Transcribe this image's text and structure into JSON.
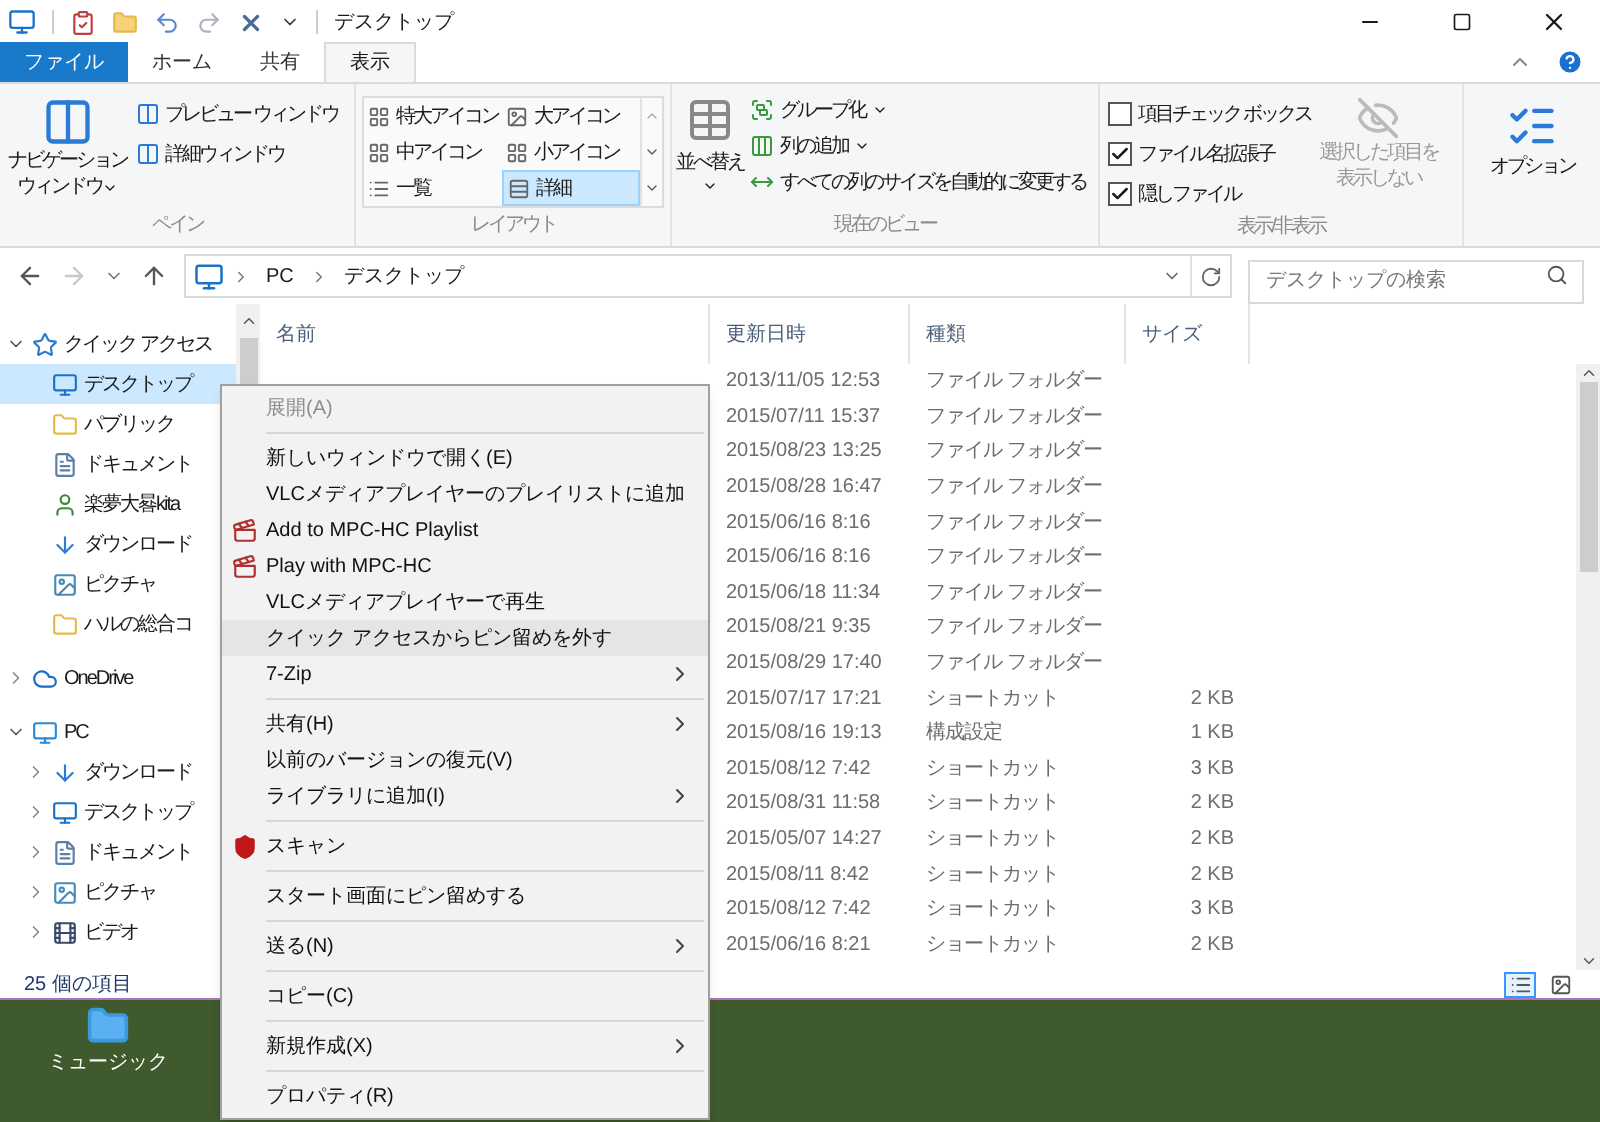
{
  "window": {
    "title": "デスクトップ"
  },
  "ribbon_tabs": [
    {
      "label": "ファイル",
      "kind": "file",
      "selected": false
    },
    {
      "label": "ホーム",
      "kind": "tab",
      "selected": false
    },
    {
      "label": "共有",
      "kind": "tab",
      "selected": false
    },
    {
      "label": "表示",
      "kind": "tab",
      "selected": true
    }
  ],
  "panes": {
    "title": "ペイン",
    "navigation_button": [
      "ナビゲーション",
      "ウィンドウ"
    ],
    "buttons": [
      "プレビュー ウィンドウ",
      "詳細ウィンドウ"
    ]
  },
  "layout": {
    "title": "レイアウト",
    "options": [
      {
        "label": "特大アイコン",
        "selected": false
      },
      {
        "label": "大アイコン",
        "selected": false
      },
      {
        "label": "中アイコン",
        "selected": false
      },
      {
        "label": "小アイコン",
        "selected": false
      },
      {
        "label": "一覧",
        "selected": false
      },
      {
        "label": "詳細",
        "selected": true
      }
    ]
  },
  "current_view": {
    "title": "現在のビュー",
    "sort_button": "並べ替え",
    "buttons": [
      {
        "label": "グループ化",
        "dropdown": true
      },
      {
        "label": "列の追加",
        "dropdown": true
      },
      {
        "label": "すべての列のサイズを自動的に変更する",
        "dropdown": false
      }
    ]
  },
  "show_hide": {
    "title": "表示/非表示",
    "checkboxes": [
      {
        "label": "項目チェック ボックス",
        "checked": false
      },
      {
        "label": "ファイル名拡張子",
        "checked": true
      },
      {
        "label": "隠しファイル",
        "checked": true
      }
    ],
    "hide_button": {
      "lines": [
        "選択した項目を",
        "表示しない"
      ],
      "disabled": true
    }
  },
  "options_button": "オプション",
  "address": {
    "forward_disabled": true,
    "path": [
      "PC",
      "デスクトップ"
    ],
    "search_placeholder": "デスクトップの検索"
  },
  "navigation": [
    {
      "label": "クイック アクセス",
      "kind": "star",
      "expanded": true,
      "selected": false,
      "children": [
        {
          "label": "デスクトップ",
          "kind": "desktop",
          "selected": true
        },
        {
          "label": "パブリック",
          "kind": "folder",
          "selected": false
        },
        {
          "label": "ドキュメント",
          "kind": "document",
          "selected": false
        },
        {
          "label": "楽夢大晷kita",
          "kind": "user",
          "selected": false
        },
        {
          "label": "ダウンロード",
          "kind": "download",
          "selected": false
        },
        {
          "label": "ピクチャ",
          "kind": "pictures",
          "selected": false
        },
        {
          "label": "ハルの総合コ",
          "kind": "folder",
          "selected": false
        }
      ]
    },
    {
      "label": "OneDrive",
      "kind": "cloud",
      "expanded": false,
      "selected": false
    },
    {
      "label": "PC",
      "kind": "pc",
      "expanded": true,
      "selected": false,
      "children": [
        {
          "label": "ダウンロード",
          "kind": "download",
          "expanded": false,
          "selected": false
        },
        {
          "label": "デスクトップ",
          "kind": "desktop",
          "expanded": false,
          "selected": false
        },
        {
          "label": "ドキュメント",
          "kind": "document",
          "expanded": false,
          "selected": false
        },
        {
          "label": "ピクチャ",
          "kind": "pictures",
          "expanded": false,
          "selected": false
        },
        {
          "label": "ビデオ",
          "kind": "video",
          "expanded": false,
          "selected": false
        }
      ]
    }
  ],
  "file_list": {
    "columns": [
      "名前",
      "更新日時",
      "種類",
      "サイズ"
    ],
    "rows": [
      {
        "modified": "2013/11/05 12:53",
        "type": "ファイル フォルダー"
      },
      {
        "modified": "2015/07/11 15:37",
        "type": "ファイル フォルダー"
      },
      {
        "modified": "2015/08/23 13:25",
        "type": "ファイル フォルダー"
      },
      {
        "modified": "2015/08/28 16:47",
        "type": "ファイル フォルダー"
      },
      {
        "modified": "2015/06/16 8:16",
        "type": "ファイル フォルダー"
      },
      {
        "modified": "2015/06/16 8:16",
        "type": "ファイル フォルダー"
      },
      {
        "modified": "2015/06/18 11:34",
        "type": "ファイル フォルダー"
      },
      {
        "modified": "2015/08/21 9:35",
        "type": "ファイル フォルダー"
      },
      {
        "modified": "2015/08/29 17:40",
        "type": "ファイル フォルダー"
      },
      {
        "modified": "2015/07/17 17:21",
        "type": "ショートカット",
        "size": "2 KB"
      },
      {
        "modified": "2015/08/16 19:13",
        "type": "構成設定",
        "size": "1 KB"
      },
      {
        "modified": "2015/08/12 7:42",
        "type": "ショートカット",
        "size": "3 KB"
      },
      {
        "modified": "2015/08/31 11:58",
        "type": "ショートカット",
        "size": "2 KB"
      },
      {
        "modified": "2015/05/07 14:27",
        "type": "ショートカット",
        "size": "2 KB"
      },
      {
        "modified": "2015/08/11 8:42",
        "type": "ショートカット",
        "size": "2 KB"
      },
      {
        "modified": "2015/08/12 7:42",
        "type": "ショートカット",
        "size": "3 KB"
      },
      {
        "modified": "2015/06/16 8:21",
        "type": "ショートカット",
        "size": "2 KB"
      }
    ]
  },
  "status_bar": {
    "item_count": "25 個の項目",
    "views": [
      {
        "kind": "details",
        "selected": true
      },
      {
        "kind": "large_icons",
        "selected": false
      }
    ]
  },
  "desktop_icons": [
    {
      "label": "ミュージック"
    }
  ],
  "context_menu": [
    {
      "kind": "item",
      "label": "展開(A)",
      "disabled": true,
      "selected": false,
      "submenu": false
    },
    {
      "kind": "separator"
    },
    {
      "kind": "item",
      "label": "新しいウィンドウで開く(E)",
      "disabled": false,
      "selected": false,
      "submenu": false
    },
    {
      "kind": "item",
      "label": "VLCメディアプレイヤーのプレイリストに追加",
      "disabled": false,
      "selected": false,
      "submenu": false
    },
    {
      "kind": "media_item",
      "label": "Add to MPC-HC Playlist",
      "disabled": false,
      "selected": false,
      "submenu": false
    },
    {
      "kind": "media_item",
      "label": "Play with MPC-HC",
      "disabled": false,
      "selected": false,
      "submenu": false
    },
    {
      "kind": "item",
      "label": "VLCメディアプレイヤーで再生",
      "disabled": false,
      "selected": false,
      "submenu": false
    },
    {
      "kind": "item",
      "label": "クイック アクセスからピン留めを外す",
      "disabled": false,
      "selected": true,
      "submenu": false
    },
    {
      "kind": "item",
      "label": "7-Zip",
      "disabled": false,
      "selected": false,
      "submenu": true
    },
    {
      "kind": "separator"
    },
    {
      "kind": "item",
      "label": "共有(H)",
      "disabled": false,
      "selected": false,
      "submenu": true
    },
    {
      "kind": "item",
      "label": "以前のバージョンの復元(V)",
      "disabled": false,
      "selected": false,
      "submenu": false
    },
    {
      "kind": "item",
      "label": "ライブラリに追加(I)",
      "disabled": false,
      "selected": false,
      "submenu": true
    },
    {
      "kind": "separator"
    },
    {
      "kind": "scan_item",
      "label": "スキャン",
      "disabled": false,
      "selected": false,
      "submenu": false
    },
    {
      "kind": "separator"
    },
    {
      "kind": "item",
      "label": "スタート画面にピン留めする",
      "disabled": false,
      "selected": false,
      "submenu": false
    },
    {
      "kind": "separator"
    },
    {
      "kind": "item",
      "label": "送る(N)",
      "disabled": false,
      "selected": false,
      "submenu": true
    },
    {
      "kind": "separator"
    },
    {
      "kind": "item",
      "label": "コピー(C)",
      "disabled": false,
      "selected": false,
      "submenu": false
    },
    {
      "kind": "separator"
    },
    {
      "kind": "item",
      "label": "新規作成(X)",
      "disabled": false,
      "selected": false,
      "submenu": true
    },
    {
      "kind": "separator"
    },
    {
      "kind": "item",
      "label": "プロパティ(R)",
      "disabled": false,
      "selected": false,
      "submenu": false
    }
  ]
}
